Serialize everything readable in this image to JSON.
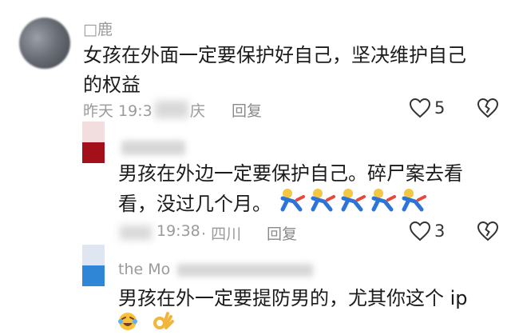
{
  "comments": [
    {
      "username": "□鹿",
      "text_line1": "女孩在外面一定要保护好自己，坚决维护自己",
      "text_line2": "的权益",
      "time": "昨天 19:3",
      "location": "庆",
      "reply_label": "回复",
      "likes": "5",
      "like_icon": "heart-outline-icon",
      "dislike_icon": "broken-heart-icon"
    },
    {
      "username": "",
      "text_line1": "男孩在外边一定要保护自己。碎尸案去看",
      "text_line2": "看，没过几个月。",
      "time": "19:38",
      "location": "· 四川",
      "reply_label": "回复",
      "likes": "3",
      "emoji_count": 5,
      "emoji_icon": "running-person-emoji-icon",
      "like_icon": "heart-outline-icon",
      "dislike_icon": "broken-heart-icon"
    },
    {
      "username": "the Mo",
      "text_line1": "男孩在外一定要提防男的，尤其你这个 ip",
      "emoji_icons": [
        "laughing-crying-emoji-icon",
        "ok-hand-emoji-icon"
      ]
    }
  ],
  "colors": {
    "text": "#1b1b1b",
    "meta": "#9a9a9a",
    "avatar2_accent": "#a3101a",
    "avatar3_accent": "#2f86d6"
  }
}
